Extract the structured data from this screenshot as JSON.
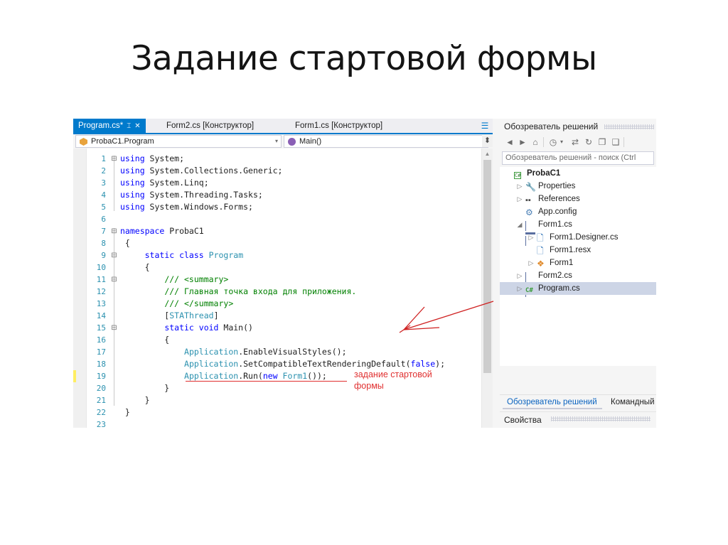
{
  "slide": {
    "title": "Задание стартовой формы"
  },
  "editor": {
    "tabs": [
      {
        "label": "Program.cs*",
        "active": true,
        "pin_icon": "pin-icon",
        "close_icon": "close-icon"
      },
      {
        "label": "Form2.cs [Конструктор]",
        "active": false
      },
      {
        "label": "Form1.cs [Конструктор]",
        "active": false
      }
    ],
    "tab_overflow_icon": "chevron-double-down-icon",
    "navbar": {
      "class_combo": {
        "value": "ProbaC1.Program",
        "icon": "class-cube-icon",
        "arrow": "chevron-down-icon"
      },
      "member_combo": {
        "value": "Main()",
        "icon": "method-icon",
        "arrow": "chevron-down-icon"
      }
    },
    "lines": [
      {
        "n": "1",
        "fold": "-",
        "tokens": [
          {
            "t": "using",
            "c": "kw"
          },
          {
            "t": " System;",
            "c": "pln"
          }
        ]
      },
      {
        "n": "2",
        "fold": "",
        "tokens": [
          {
            "t": "using",
            "c": "kw"
          },
          {
            "t": " System.Collections.Generic;",
            "c": "pln"
          }
        ]
      },
      {
        "n": "3",
        "fold": "",
        "tokens": [
          {
            "t": "using",
            "c": "kw"
          },
          {
            "t": " System.Linq;",
            "c": "pln"
          }
        ]
      },
      {
        "n": "4",
        "fold": "",
        "tokens": [
          {
            "t": "using",
            "c": "kw"
          },
          {
            "t": " System.Threading.Tasks;",
            "c": "pln"
          }
        ]
      },
      {
        "n": "5",
        "fold": "",
        "tokens": [
          {
            "t": "using",
            "c": "kw"
          },
          {
            "t": " System.Windows.Forms;",
            "c": "pln"
          }
        ]
      },
      {
        "n": "6",
        "fold": "",
        "tokens": []
      },
      {
        "n": "7",
        "fold": "-",
        "tokens": [
          {
            "t": "namespace",
            "c": "kw"
          },
          {
            "t": " ProbaC1",
            "c": "pln"
          }
        ]
      },
      {
        "n": "8",
        "fold": "",
        "tokens": [
          {
            "t": " {",
            "c": "pln"
          }
        ]
      },
      {
        "n": "9",
        "fold": "-",
        "tokens": [
          {
            "t": "     ",
            "c": "pln"
          },
          {
            "t": "static class",
            "c": "kw"
          },
          {
            "t": " ",
            "c": "pln"
          },
          {
            "t": "Program",
            "c": "type"
          }
        ]
      },
      {
        "n": "10",
        "fold": "",
        "tokens": [
          {
            "t": "     {",
            "c": "pln"
          }
        ]
      },
      {
        "n": "11",
        "fold": "-",
        "tokens": [
          {
            "t": "         ",
            "c": "pln"
          },
          {
            "t": "/// <summary>",
            "c": "cmt"
          }
        ]
      },
      {
        "n": "12",
        "fold": "",
        "tokens": [
          {
            "t": "         ",
            "c": "pln"
          },
          {
            "t": "/// Главная точка входа для приложения.",
            "c": "cmt"
          }
        ]
      },
      {
        "n": "13",
        "fold": "",
        "tokens": [
          {
            "t": "         ",
            "c": "pln"
          },
          {
            "t": "/// </summary>",
            "c": "cmt"
          }
        ]
      },
      {
        "n": "14",
        "fold": "",
        "tokens": [
          {
            "t": "         [",
            "c": "pln"
          },
          {
            "t": "STAThread",
            "c": "type"
          },
          {
            "t": "]",
            "c": "pln"
          }
        ]
      },
      {
        "n": "15",
        "fold": "-",
        "tokens": [
          {
            "t": "         ",
            "c": "pln"
          },
          {
            "t": "static void",
            "c": "kw"
          },
          {
            "t": " Main()",
            "c": "pln"
          }
        ]
      },
      {
        "n": "16",
        "fold": "",
        "tokens": [
          {
            "t": "         {",
            "c": "pln"
          }
        ]
      },
      {
        "n": "17",
        "fold": "",
        "tokens": [
          {
            "t": "             ",
            "c": "pln"
          },
          {
            "t": "Application",
            "c": "type"
          },
          {
            "t": ".EnableVisualStyles();",
            "c": "pln"
          }
        ]
      },
      {
        "n": "18",
        "fold": "",
        "tokens": [
          {
            "t": "             ",
            "c": "pln"
          },
          {
            "t": "Application",
            "c": "type"
          },
          {
            "t": ".SetCompatibleTextRenderingDefault(",
            "c": "pln"
          },
          {
            "t": "false",
            "c": "kw"
          },
          {
            "t": ");",
            "c": "pln"
          }
        ]
      },
      {
        "n": "19",
        "fold": "",
        "tokens": [
          {
            "t": "             ",
            "c": "pln"
          },
          {
            "t": "Application",
            "c": "type"
          },
          {
            "t": ".Run(",
            "c": "pln"
          },
          {
            "t": "new",
            "c": "kw"
          },
          {
            "t": " ",
            "c": "pln"
          },
          {
            "t": "Form1",
            "c": "type"
          },
          {
            "t": "());",
            "c": "pln"
          }
        ]
      },
      {
        "n": "20",
        "fold": "",
        "tokens": [
          {
            "t": "         }",
            "c": "pln"
          }
        ]
      },
      {
        "n": "21",
        "fold": "",
        "tokens": [
          {
            "t": "     }",
            "c": "pln"
          }
        ]
      },
      {
        "n": "22",
        "fold": "",
        "tokens": [
          {
            "t": " }",
            "c": "pln"
          }
        ]
      },
      {
        "n": "23",
        "fold": "",
        "tokens": []
      }
    ],
    "annotation": {
      "line1": "задание стартовой",
      "line2": "формы",
      "color": "#e03030"
    },
    "scrollbar": {
      "up_icon": "scroll-up-arrow-icon",
      "split_icon": "split-view-icon"
    }
  },
  "solution_explorer": {
    "title": "Обозреватель решений",
    "toolbar": [
      {
        "name": "back-button",
        "glyph": "◄"
      },
      {
        "name": "forward-button",
        "glyph": "►"
      },
      {
        "name": "home-button",
        "glyph": "⌂"
      },
      {
        "name": "pending-changes-button",
        "glyph": "◷"
      },
      {
        "name": "pending-changes-dropdown",
        "glyph": "▾"
      },
      {
        "name": "sync-with-active-document-button",
        "glyph": "⇄"
      },
      {
        "name": "refresh-button",
        "glyph": "↻"
      },
      {
        "name": "collapse-all-button",
        "glyph": "❐"
      },
      {
        "name": "show-all-files-button",
        "glyph": "❑"
      }
    ],
    "search_placeholder": "Обозреватель решений - поиск (Ctrl",
    "tree": [
      {
        "label": "ProbaC1",
        "indent": 0,
        "expander": "",
        "icon": "csharp-project-icon",
        "bold": true,
        "selected": false
      },
      {
        "label": "Properties",
        "indent": 1,
        "expander": "▷",
        "icon": "properties-wrench-icon",
        "bold": false,
        "selected": false
      },
      {
        "label": "References",
        "indent": 1,
        "expander": "▷",
        "icon": "references-icon",
        "bold": false,
        "selected": false
      },
      {
        "label": "App.config",
        "indent": 1,
        "expander": "",
        "icon": "config-file-icon",
        "bold": false,
        "selected": false
      },
      {
        "label": "Form1.cs",
        "indent": 1,
        "expander": "◢",
        "icon": "form-file-icon",
        "bold": false,
        "selected": false
      },
      {
        "label": "Form1.Designer.cs",
        "indent": 2,
        "expander": "▷",
        "icon": "code-file-icon",
        "bold": false,
        "selected": false
      },
      {
        "label": "Form1.resx",
        "indent": 2,
        "expander": "",
        "icon": "code-file-icon",
        "bold": false,
        "selected": false
      },
      {
        "label": "Form1",
        "indent": 2,
        "expander": "▷",
        "icon": "control-icon",
        "bold": false,
        "selected": false
      },
      {
        "label": "Form2.cs",
        "indent": 1,
        "expander": "▷",
        "icon": "form-file-icon",
        "bold": false,
        "selected": false
      },
      {
        "label": "Program.cs",
        "indent": 1,
        "expander": "▷",
        "icon": "csharp-file-icon",
        "bold": false,
        "selected": true
      }
    ],
    "bottom_tabs": [
      {
        "label": "Обозреватель решений",
        "active": true
      },
      {
        "label": "Командный",
        "active": false
      }
    ],
    "properties_title": "Свойства"
  }
}
